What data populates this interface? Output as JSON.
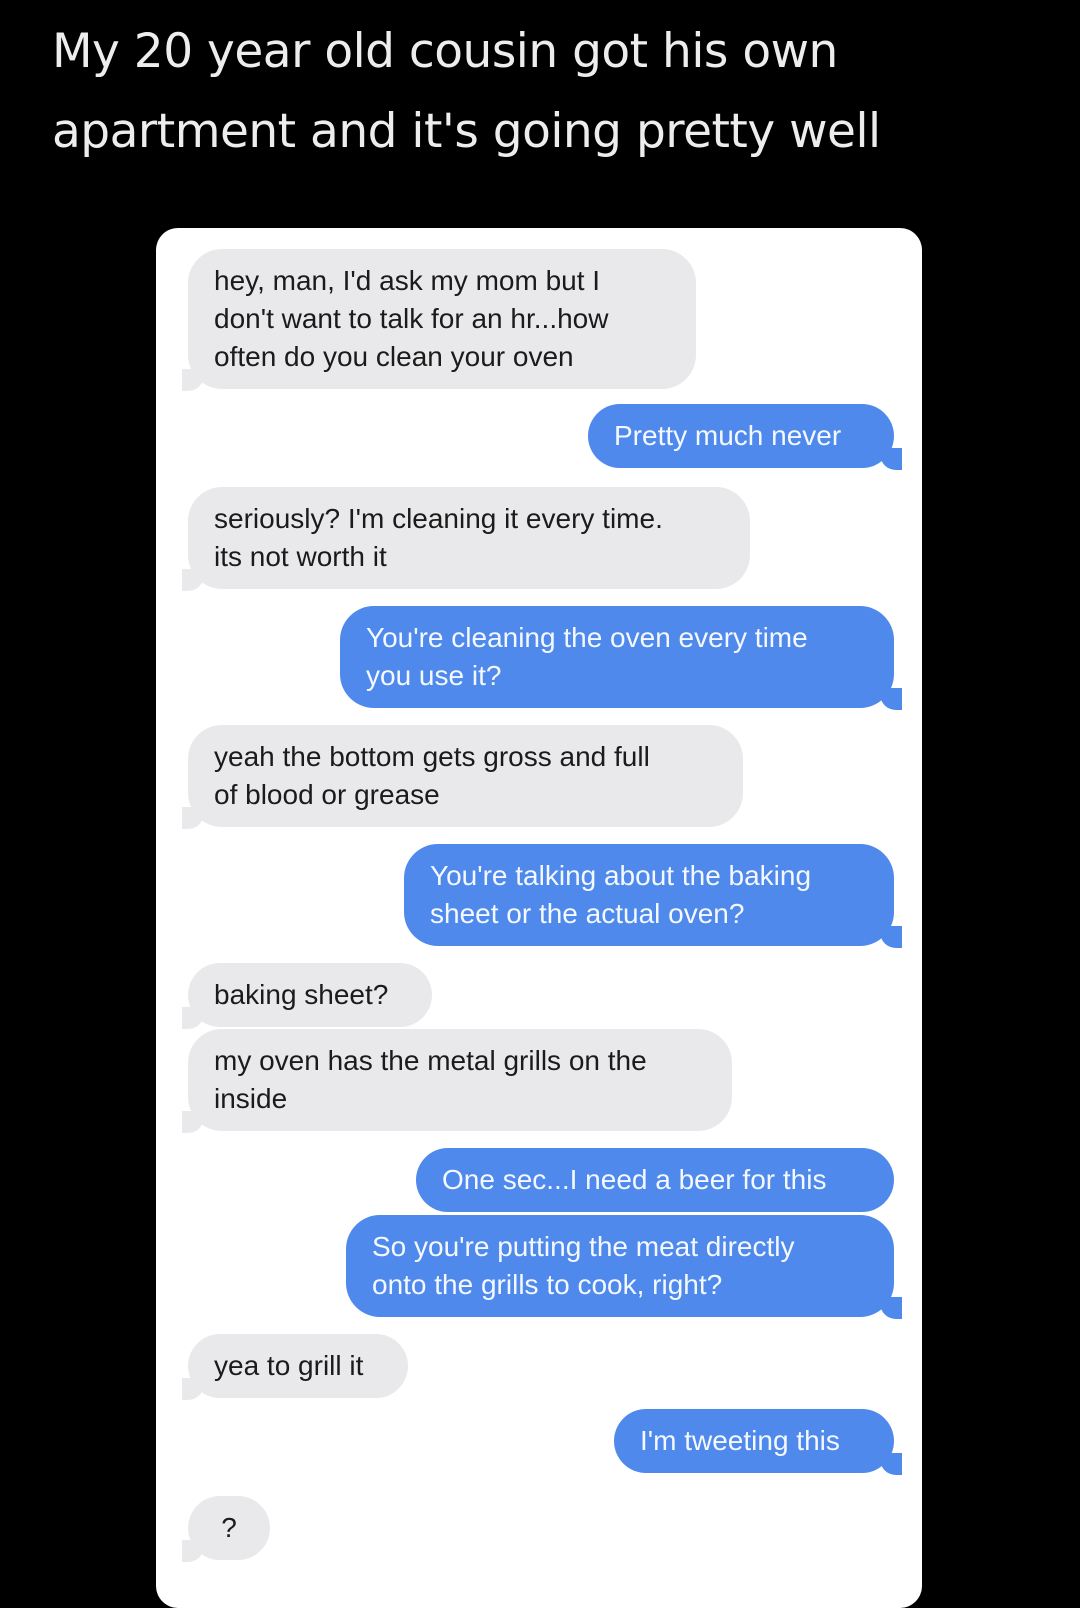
{
  "caption": {
    "line1": "My 20 year old cousin got his own",
    "line2": "apartment and it's going pretty well"
  },
  "colors": {
    "page_background": "#000000",
    "received_bubble": "#e9e9eb",
    "sent_bubble": "#4f89ec"
  },
  "messages": [
    {
      "from": "them",
      "lines": [
        "hey, man, I'd ask my mom but I",
        "don't want to talk for an hr...how",
        "often do you clean your oven"
      ]
    },
    {
      "from": "me",
      "lines": [
        "Pretty much never"
      ]
    },
    {
      "from": "them",
      "lines": [
        "seriously? I'm cleaning it every time.",
        "its not worth it"
      ]
    },
    {
      "from": "me",
      "lines": [
        "You're cleaning the oven every time",
        "you use it?"
      ]
    },
    {
      "from": "them",
      "lines": [
        "yeah the bottom gets gross and full",
        "of blood or grease"
      ]
    },
    {
      "from": "me",
      "lines": [
        "You're talking about the baking",
        "sheet or the actual oven?"
      ]
    },
    {
      "from": "them",
      "lines": [
        "baking sheet?"
      ]
    },
    {
      "from": "them",
      "lines": [
        "my oven has the metal grills on the",
        "inside"
      ]
    },
    {
      "from": "me",
      "lines": [
        "One sec...I need a beer for this"
      ]
    },
    {
      "from": "me",
      "lines": [
        "So you're putting the meat directly",
        "onto the grills to cook, right?"
      ]
    },
    {
      "from": "them",
      "lines": [
        "yea to grill it"
      ]
    },
    {
      "from": "me",
      "lines": [
        "I'm tweeting this"
      ]
    },
    {
      "from": "them",
      "lines": [
        "?"
      ]
    }
  ]
}
